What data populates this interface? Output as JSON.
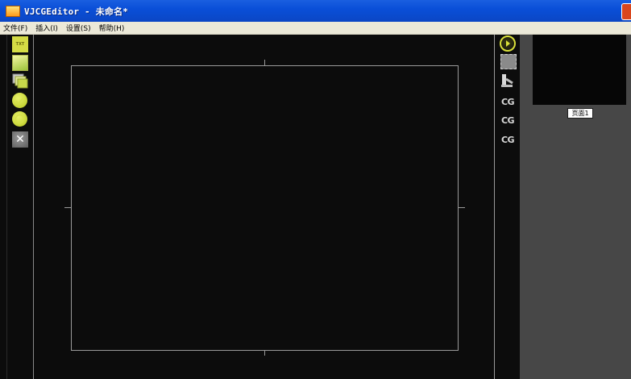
{
  "window": {
    "title": "VJCGEditor - 未命名*"
  },
  "menu": [
    {
      "label": "文件(F)"
    },
    {
      "label": "插入(I)"
    },
    {
      "label": "设置(S)"
    },
    {
      "label": "帮助(H)"
    }
  ],
  "left_toolbar": {
    "txt_tool_label": "TXT",
    "tools": [
      "text-tool",
      "image-tool",
      "multi-image-tool",
      "confirm-tool",
      "refresh-tool",
      "delete-tool"
    ],
    "delete_glyph": "✕"
  },
  "right_toolbar": {
    "tools": [
      "play-tool",
      "film-tool",
      "brush-tool",
      "cg-confirm-tool",
      "cg-upload-tool",
      "cg-delete-tool"
    ],
    "cg_label": "CG"
  },
  "pages": [
    {
      "label": "页面1"
    }
  ],
  "colors": {
    "titlebar": "#0a4fd8",
    "menubar": "#ece9d8",
    "canvas": "#0c0c0c",
    "pages_panel": "#474747",
    "accent_yellow": "#d4dc45"
  }
}
